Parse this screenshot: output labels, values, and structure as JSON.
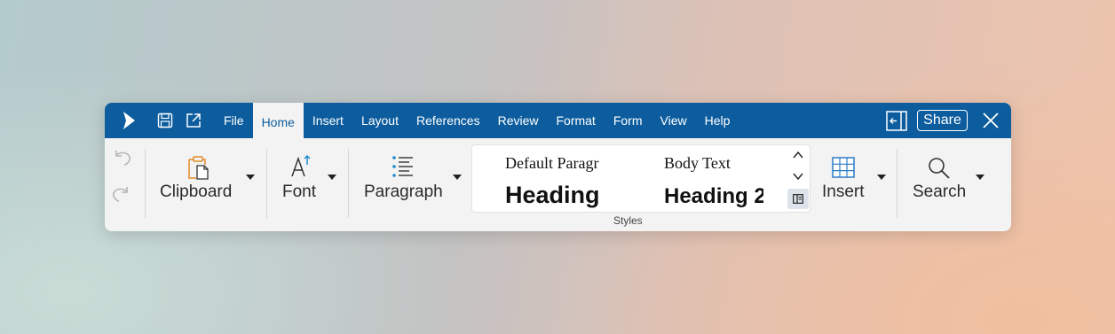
{
  "titlebar": {
    "menu": [
      "File",
      "Home",
      "Insert",
      "Layout",
      "References",
      "Review",
      "Format",
      "Form",
      "View",
      "Help"
    ],
    "active_menu": "Home",
    "share_label": "Share",
    "icons": [
      "app-logo-icon",
      "save-icon",
      "open-external-icon",
      "panel-toggle-icon",
      "close-icon"
    ],
    "accent_color": "#0d5d9e"
  },
  "ribbon": {
    "groups": {
      "clipboard": "Clipboard",
      "font": "Font",
      "paragraph": "Paragraph",
      "insert": "Insert",
      "search": "Search"
    },
    "styles": {
      "items": [
        "Default Paragr",
        "Body Text",
        "Heading",
        "Heading 2"
      ],
      "label": "Styles"
    },
    "history_icons": [
      "undo-icon",
      "redo-icon"
    ]
  }
}
